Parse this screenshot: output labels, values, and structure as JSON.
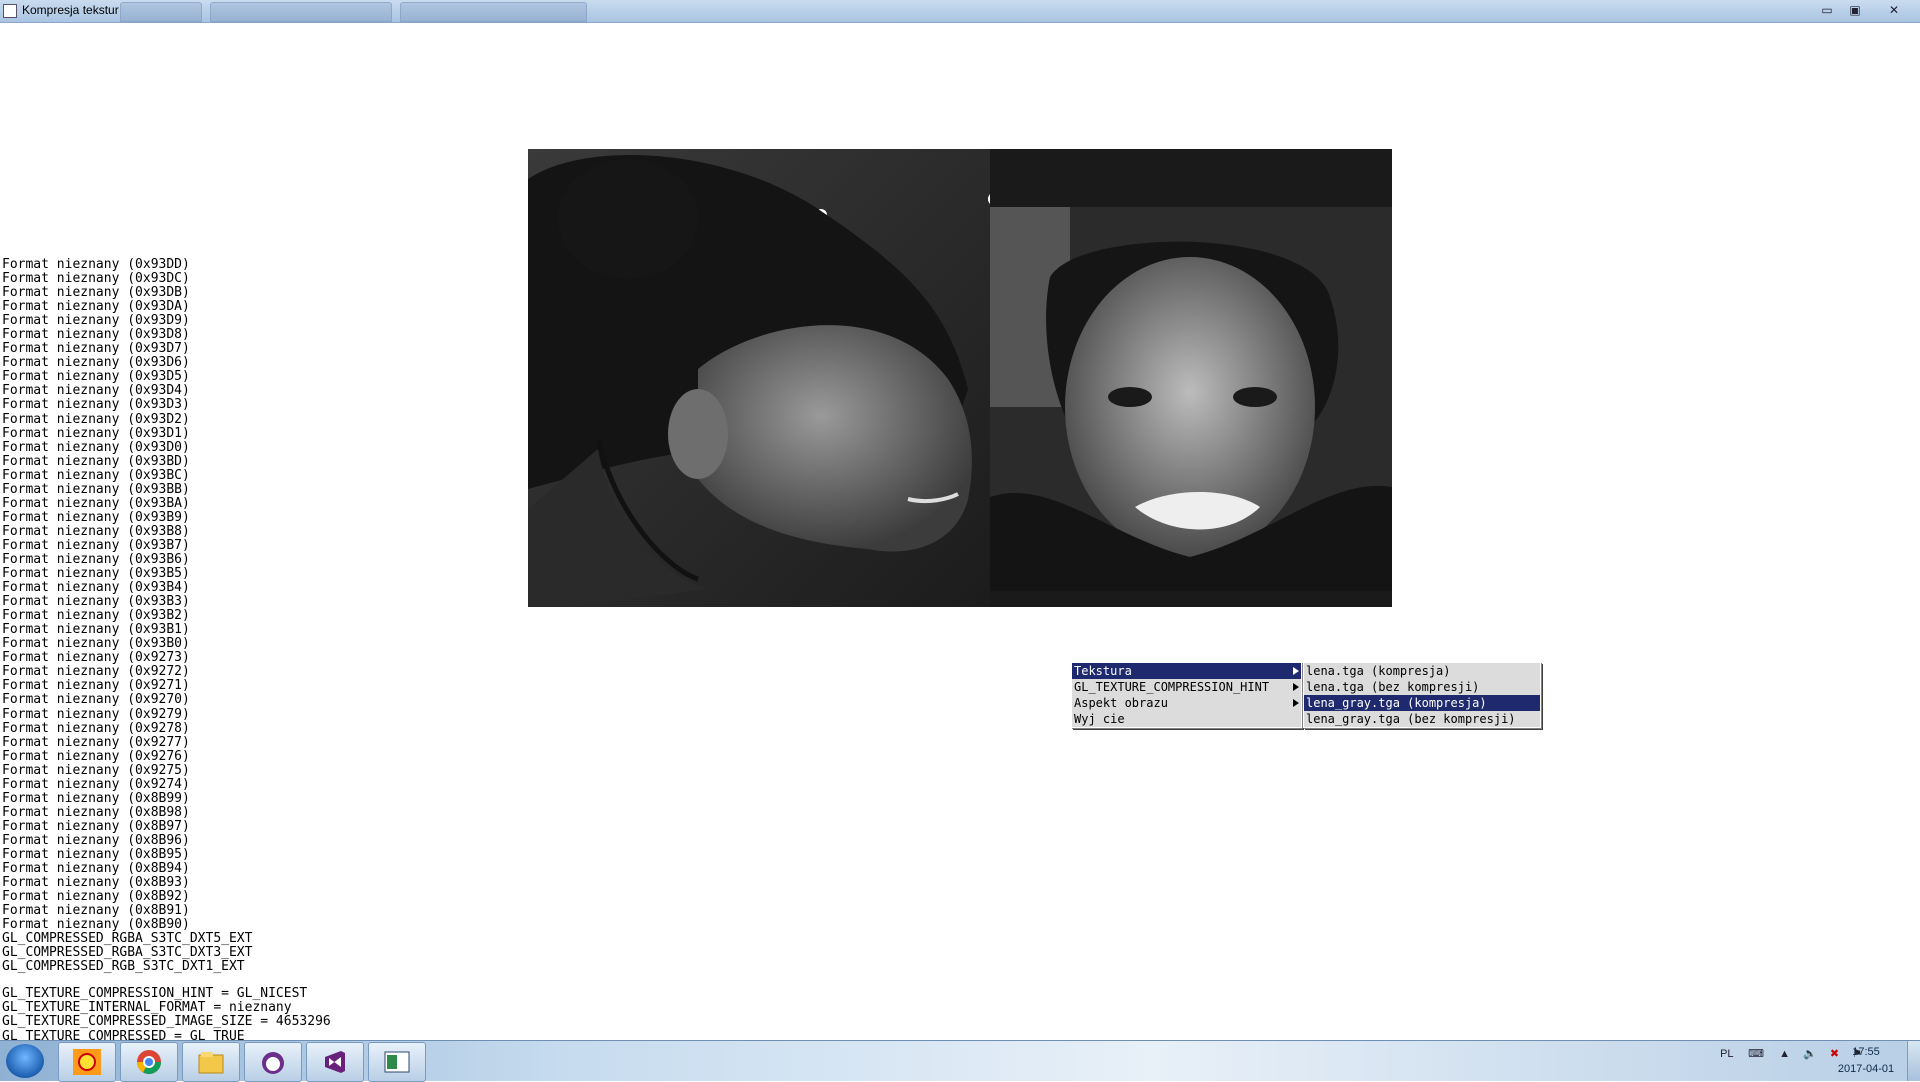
{
  "window": {
    "title": "Kompresja tekstur",
    "background_tabs": [
      "",
      "",
      ""
    ]
  },
  "window_controls": {
    "minimize": "▭",
    "maximize": "▣",
    "close": "✕"
  },
  "console_lines": [
    "Format nieznany (0x93DD)",
    "Format nieznany (0x93DC)",
    "Format nieznany (0x93DB)",
    "Format nieznany (0x93DA)",
    "Format nieznany (0x93D9)",
    "Format nieznany (0x93D8)",
    "Format nieznany (0x93D7)",
    "Format nieznany (0x93D6)",
    "Format nieznany (0x93D5)",
    "Format nieznany (0x93D4)",
    "Format nieznany (0x93D3)",
    "Format nieznany (0x93D2)",
    "Format nieznany (0x93D1)",
    "Format nieznany (0x93D0)",
    "Format nieznany (0x93BD)",
    "Format nieznany (0x93BC)",
    "Format nieznany (0x93BB)",
    "Format nieznany (0x93BA)",
    "Format nieznany (0x93B9)",
    "Format nieznany (0x93B8)",
    "Format nieznany (0x93B7)",
    "Format nieznany (0x93B6)",
    "Format nieznany (0x93B5)",
    "Format nieznany (0x93B4)",
    "Format nieznany (0x93B3)",
    "Format nieznany (0x93B2)",
    "Format nieznany (0x93B1)",
    "Format nieznany (0x93B0)",
    "Format nieznany (0x9273)",
    "Format nieznany (0x9272)",
    "Format nieznany (0x9271)",
    "Format nieznany (0x9270)",
    "Format nieznany (0x9279)",
    "Format nieznany (0x9278)",
    "Format nieznany (0x9277)",
    "Format nieznany (0x9276)",
    "Format nieznany (0x9275)",
    "Format nieznany (0x9274)",
    "Format nieznany (0x8B99)",
    "Format nieznany (0x8B98)",
    "Format nieznany (0x8B97)",
    "Format nieznany (0x8B96)",
    "Format nieznany (0x8B95)",
    "Format nieznany (0x8B94)",
    "Format nieznany (0x8B93)",
    "Format nieznany (0x8B92)",
    "Format nieznany (0x8B91)",
    "Format nieznany (0x8B90)",
    "GL_COMPRESSED_RGBA_S3TC_DXT5_EXT",
    "GL_COMPRESSED_RGBA_S3TC_DXT3_EXT",
    "GL_COMPRESSED_RGB_S3TC_DXT1_EXT"
  ],
  "status_lines": [
    "GL_TEXTURE_COMPRESSION_HINT = GL_NICEST",
    "GL_TEXTURE_INTERNAL_FORMAT = nieznany",
    "GL_TEXTURE_COMPRESSED_IMAGE_SIZE = 4653296",
    "GL_TEXTURE_COMPRESSED = GL_TRUE"
  ],
  "context_menu": {
    "items": [
      {
        "label": "Tekstura",
        "submenu": true,
        "active": true
      },
      {
        "label": "GL_TEXTURE_COMPRESSION_HINT",
        "submenu": true,
        "active": false
      },
      {
        "label": "Aspekt obrazu",
        "submenu": true,
        "active": false
      },
      {
        "label": "Wyj cie",
        "submenu": false,
        "active": false
      }
    ]
  },
  "texture_submenu": {
    "items": [
      {
        "label": "lena.tga (kompresja)",
        "active": false
      },
      {
        "label": "lena.tga (bez kompresji)",
        "active": false
      },
      {
        "label": "lena_gray.tga (kompresja)",
        "active": true
      },
      {
        "label": "lena_gray.tga (bez kompresji)",
        "active": false
      }
    ]
  },
  "taskbar": {
    "pinned_icons": [
      "sun-app-icon",
      "chrome-icon",
      "file-explorer-icon",
      "cat-app-icon",
      "visual-studio-icon",
      "app-window-icon"
    ],
    "language": "PL",
    "time": "17:55",
    "date": "2017-04-01"
  },
  "colors": {
    "menu_highlight": "#1f2a6e",
    "menu_background": "#dcdcdc",
    "titlebar": "#b9cfe8"
  }
}
